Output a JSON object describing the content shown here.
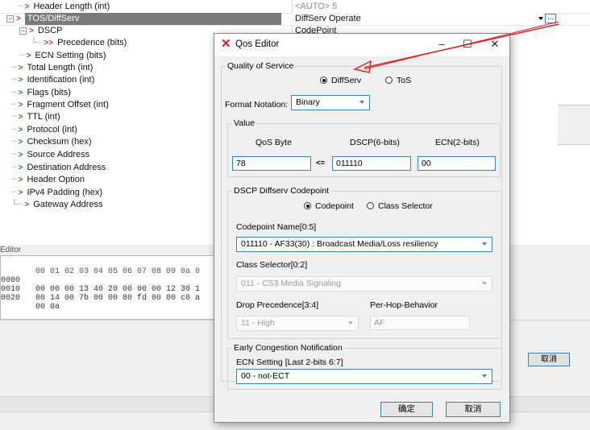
{
  "tree": {
    "rows": [
      {
        "label": "Header Length (int)",
        "value": "<AUTO> 5"
      },
      {
        "label": "TOS/DiffServ",
        "value": "DiffServ Operate"
      },
      {
        "label": "DSCP",
        "value": "CodePoint"
      },
      {
        "label": "Precedence (bits)"
      },
      {
        "label": "ECN Setting (bits)"
      },
      {
        "label": "Total Length (int)"
      },
      {
        "label": "Identification  (int)"
      },
      {
        "label": "Flags (bits)"
      },
      {
        "label": "Fragment Offset (int)"
      },
      {
        "label": "TTL (int)"
      },
      {
        "label": "Protocol (int)"
      },
      {
        "label": "Checksum (hex)"
      },
      {
        "label": "Source Address"
      },
      {
        "label": "Destination Address"
      },
      {
        "label": "Header Option"
      },
      {
        "label": "IPv4 Padding (hex)"
      },
      {
        "label": "Gateway Address"
      }
    ],
    "ellipsis_label": "..."
  },
  "editor": {
    "label": "Editor",
    "header": "00 01 02 03 04 05 06 07 08 09 0a 0",
    "rows": [
      {
        "offset": "0000",
        "bytes": "00 00 00 13 40 20 00 00 00 12 30 1"
      },
      {
        "offset": "0010",
        "bytes": "00 14 00 7b 00 00 80 fd 00 00 c0 a"
      },
      {
        "offset": "0020",
        "bytes": "00 0a"
      }
    ]
  },
  "background": {
    "cancel_label": "取消"
  },
  "dialog": {
    "title": "Qos Editor",
    "qos_group": "Quality of Service",
    "radio_diffserv": "DiffServ",
    "radio_tos": "ToS",
    "format_label": "Format Notation:",
    "format_value": "Binary",
    "value_group": "Value",
    "col_qos": "QoS Byte",
    "col_dscp": "DSCP(6-bits)",
    "col_ecn": "ECN(2-bits)",
    "qos_value": "78",
    "arrow_label": "<=",
    "dscp_value": "011110",
    "ecn_value": "00",
    "dscp_group": "DSCP Diffserv Codepoint",
    "radio_codepoint": "Codepoint",
    "radio_class_selector": "Class Selector",
    "codepoint_name_label": "Codepoint Name[0:5]",
    "codepoint_name_value": "011110 - AF33(30) : Broadcast Media/Loss resiliency",
    "class_selector_label": "Class Selector[0:2]",
    "class_selector_value": "011 - CS3 Media Signaling",
    "drop_precedence_label": "Drop Precedence[3:4]",
    "drop_precedence_value": "11 - High",
    "phb_label": "Per-Hop-Behavior",
    "phb_value": "AF",
    "ecn_group": "Early Congestion Notification",
    "ecn_setting_label": "ECN Setting [Last 2-bits 6:7]",
    "ecn_setting_value": "00 - not-ECT",
    "ok_label": "确定",
    "cancel_label": "取消"
  },
  "colors": {
    "accent": "#3b82c4",
    "annotation_arrow": "#e02020",
    "selected_row": "#7a7a7a",
    "title_logo": "#cc2222"
  }
}
